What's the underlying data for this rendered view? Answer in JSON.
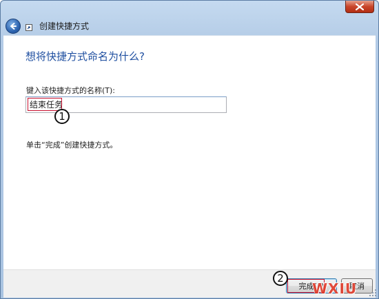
{
  "window": {
    "title": "创建快捷方式",
    "close_symbol": "✕"
  },
  "page": {
    "heading": "想将快捷方式命名为什么?",
    "name_label": "键入该快捷方式的名称(T):",
    "name_value": "结束任务",
    "hint": "单击“完成”创建快捷方式。"
  },
  "footer": {
    "finish_label": "完成(F)",
    "cancel_label": "取消"
  },
  "annotations": {
    "callout_1": "1",
    "callout_2": "2",
    "watermark": "WXIU"
  },
  "colors": {
    "heading": "#1f4fa0",
    "callout_border": "#c8102e",
    "close_button": "#c8452a"
  },
  "icons": {
    "back": "back-arrow-icon",
    "wizard": "shortcut-icon",
    "close": "close-icon"
  }
}
